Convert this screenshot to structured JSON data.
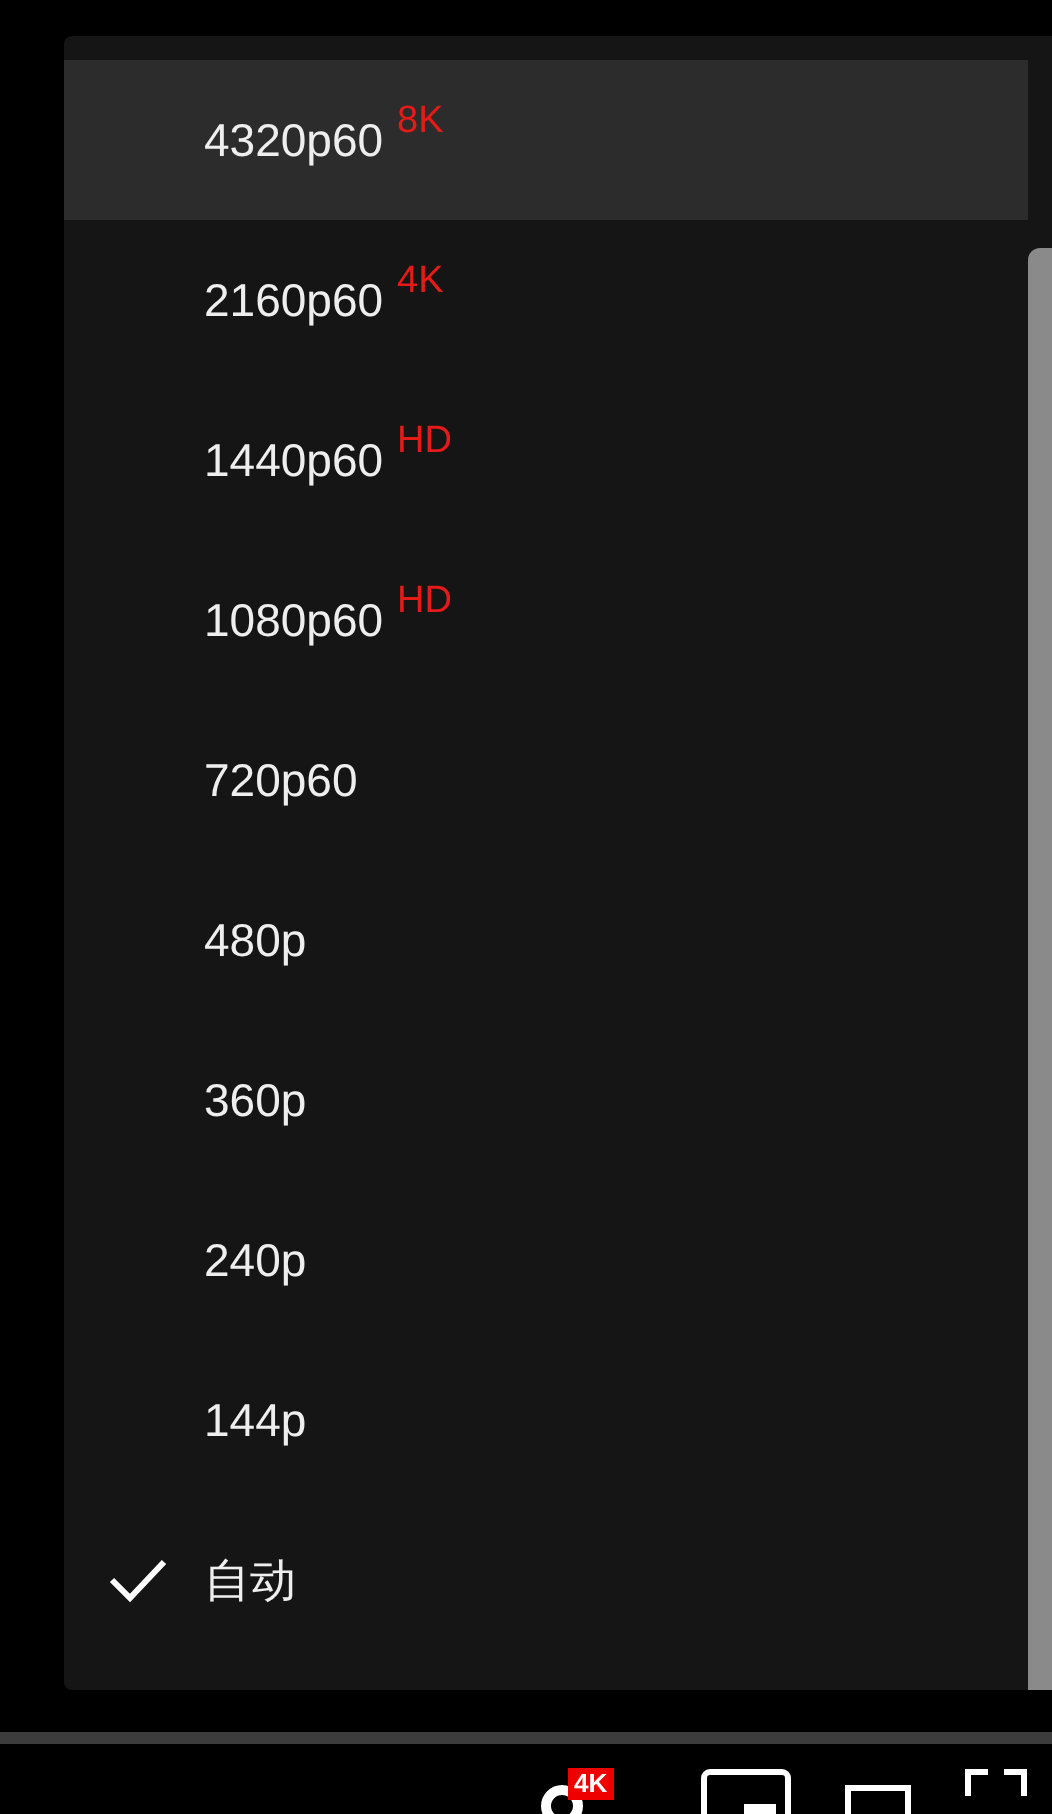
{
  "quality_menu": {
    "items": [
      {
        "label": "4320p60",
        "badge": "8K",
        "selected": false,
        "highlighted": true
      },
      {
        "label": "2160p60",
        "badge": "4K",
        "selected": false,
        "highlighted": false
      },
      {
        "label": "1440p60",
        "badge": "HD",
        "selected": false,
        "highlighted": false
      },
      {
        "label": "1080p60",
        "badge": "HD",
        "selected": false,
        "highlighted": false
      },
      {
        "label": "720p60",
        "selected": false,
        "highlighted": false
      },
      {
        "label": "480p",
        "selected": false,
        "highlighted": false
      },
      {
        "label": "360p",
        "selected": false,
        "highlighted": false
      },
      {
        "label": "240p",
        "selected": false,
        "highlighted": false
      },
      {
        "label": "144p",
        "selected": false,
        "highlighted": false
      },
      {
        "label": "自动",
        "selected": true,
        "highlighted": false
      }
    ]
  },
  "player_controls": {
    "settings_badge": "4K"
  }
}
